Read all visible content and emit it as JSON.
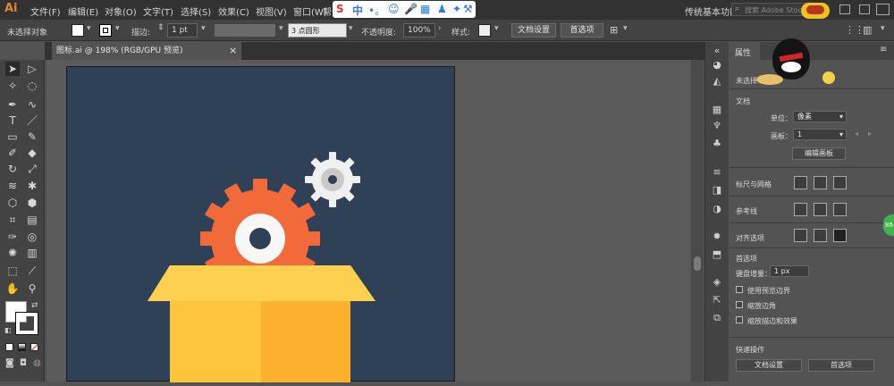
{
  "app": {
    "logo": "Ai"
  },
  "menu": [
    "文件(F)",
    "编辑(E)",
    "对象(O)",
    "文字(T)",
    "选择(S)",
    "效果(C)",
    "视图(V)",
    "窗口(W)",
    "帮"
  ],
  "ime": {
    "label": "中",
    "extra": "•。"
  },
  "workspace": {
    "label": "传统基本功能"
  },
  "search": {
    "placeholder": "搜索 Adobe Stock"
  },
  "control": {
    "no_selection": "未选择对象",
    "stroke_label": "描边:",
    "stroke_value": "1 pt",
    "brush_value": "3 点圆形",
    "opacity_label": "不透明度:",
    "opacity_value": "100%",
    "style_label": "样式:",
    "doc_setup": "文档设置",
    "preferences": "首选项"
  },
  "tab": {
    "title": "图标.ai @ 198% (RGB/GPU 预览)",
    "close": "×"
  },
  "panel": {
    "tab_title": "属性",
    "no_selection": "未选择",
    "document_section": "文档",
    "unit_label": "单位：",
    "unit_value": "像素",
    "artboard_label": "画板：",
    "artboard_value": "1",
    "edit_artboard": "编辑画板",
    "rulers_grid": "标尺与网格",
    "guides": "参考线",
    "snap_options": "对齐选项",
    "preferences_section": "首选项",
    "keyboard_increment_label": "键盘增量：",
    "keyboard_increment_value": "1 px",
    "cb_preview_bounds": "使用预览边界",
    "cb_scale_corners": "缩放边角",
    "cb_scale_strokes": "缩放描边和效果",
    "quick_actions": "快速操作",
    "qa_doc_setup": "文档设置",
    "qa_preferences": "首选项",
    "badge_text": "86"
  },
  "colors": {
    "artboard": "#2e4157",
    "gear_large": "#f26a3a",
    "gear_small": "#f0f0f0",
    "box_front": "#fdbf3a",
    "box_right": "#fcaa2c",
    "box_flap": "#fccf4e",
    "accent": "#e08a2d"
  }
}
